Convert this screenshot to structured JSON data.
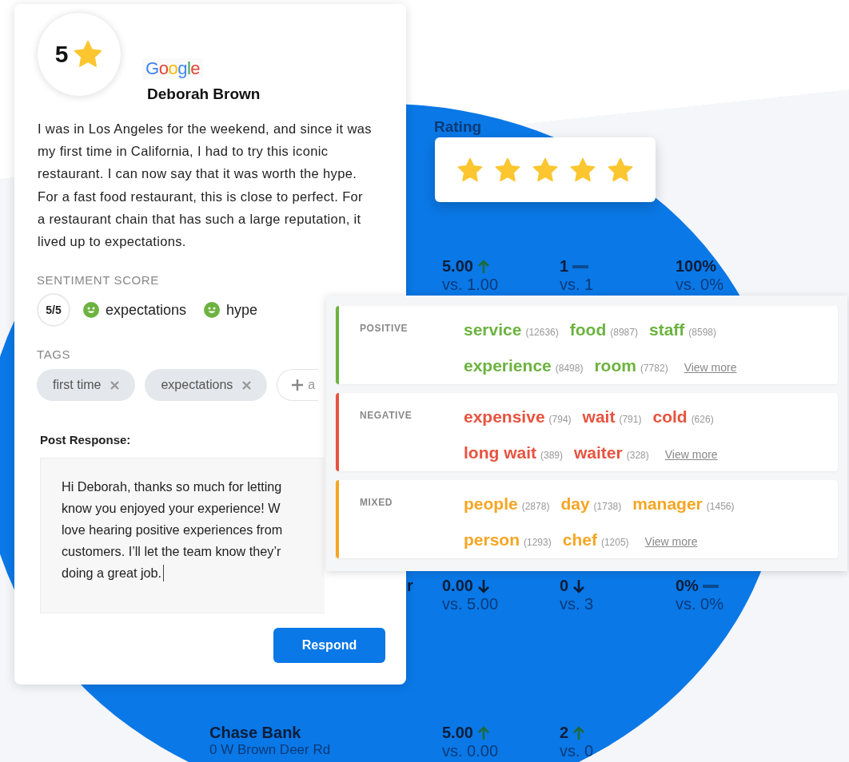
{
  "background_table": {
    "header": "Rating",
    "rows": [
      {
        "name": "",
        "address": "",
        "cells": [
          {
            "value": "5.00",
            "kind": "up",
            "compare": "vs. 1.00"
          },
          {
            "value": "1",
            "kind": "flat",
            "compare": "vs. 1"
          },
          {
            "value": "100%",
            "kind": "plain",
            "compare": "vs. 0%"
          }
        ]
      },
      {
        "name": "r",
        "address": "",
        "cells": [
          {
            "value": "0.00",
            "kind": "down",
            "compare": "vs. 5.00"
          },
          {
            "value": "0",
            "kind": "down",
            "compare": "vs. 3"
          },
          {
            "value": "0%",
            "kind": "flat",
            "compare": "vs. 0%"
          }
        ]
      },
      {
        "name": "Chase Bank",
        "address": "0 W Brown Deer Rd",
        "cells": [
          {
            "value": "5.00",
            "kind": "up",
            "compare": "vs. 0.00"
          },
          {
            "value": "2",
            "kind": "up",
            "compare": "vs. 0"
          }
        ]
      }
    ]
  },
  "review": {
    "rating": "5",
    "source": "Google",
    "author": "Deborah Brown",
    "text": "I was in Los Angeles for the weekend, and since it was my first time in California, I had to try this iconic restaurant. I can now say that it was worth the hype. For a fast food restaurant, this is close to perfect. For a restaurant chain that has such a large reputation, it lived up to expectations.",
    "sentiment_label": "SENTIMENT SCORE",
    "score": "5/5",
    "sentiment_terms": [
      {
        "label": "expectations",
        "kind": "positive"
      },
      {
        "label": "hype",
        "kind": "positive"
      }
    ],
    "tags_label": "TAGS",
    "tags": [
      "first time",
      "expectations"
    ],
    "add_tag": "a",
    "response_label": "Post Response:",
    "response_lines": [
      "Hi Deborah, thanks so much for letting",
      "know you enjoyed your experience! W",
      "love hearing positive experiences from",
      "customers. I’ll let the team know they’r",
      "doing a great job."
    ],
    "respond_button": "Respond"
  },
  "rating_stars": {
    "stars": 5
  },
  "keywords": [
    {
      "label": "POSITIVE",
      "kind": "positive",
      "terms": [
        {
          "word": "service",
          "count": "(12636)"
        },
        {
          "word": "food",
          "count": "(8987)"
        },
        {
          "word": "staff",
          "count": "(8598)"
        },
        {
          "word": "experience",
          "count": "(8498)"
        },
        {
          "word": "room",
          "count": "(7782)"
        }
      ],
      "more": "View more"
    },
    {
      "label": "NEGATIVE",
      "kind": "negative",
      "terms": [
        {
          "word": "expensive",
          "count": "(794)"
        },
        {
          "word": "wait",
          "count": "(791)"
        },
        {
          "word": "cold",
          "count": "(626)"
        },
        {
          "word": "long wait",
          "count": "(389)"
        },
        {
          "word": "waiter",
          "count": "(328)"
        }
      ],
      "more": "View more"
    },
    {
      "label": "MIXED",
      "kind": "mixed",
      "terms": [
        {
          "word": "people",
          "count": "(2878)"
        },
        {
          "word": "day",
          "count": "(1738)"
        },
        {
          "word": "manager",
          "count": "(1456)"
        },
        {
          "word": "person",
          "count": "(1293)"
        },
        {
          "word": "chef",
          "count": "(1205)"
        }
      ],
      "more": "View more"
    }
  ]
}
